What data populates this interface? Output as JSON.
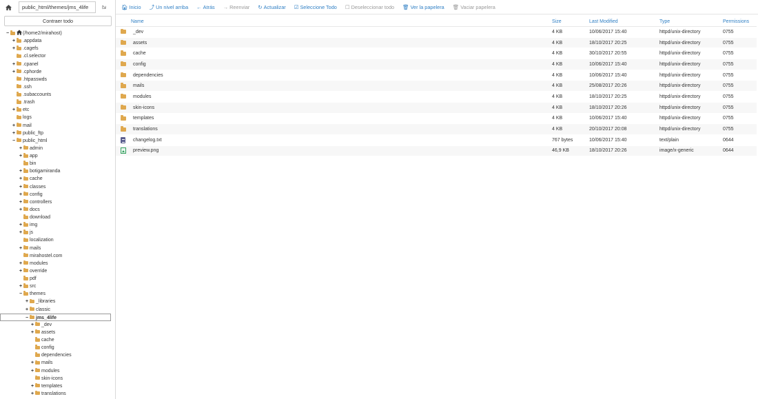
{
  "pathbar": {
    "path_value": "public_html/themes/jms_4life",
    "go_icon": "go-arrow-icon"
  },
  "sidebar": {
    "collapse_label": "Contraer todo",
    "tree": [
      {
        "label": "(/home2/mirahost)",
        "depth": 0,
        "toggle": "−",
        "icon": "home",
        "selected": false
      },
      {
        "label": ".appdata",
        "depth": 1,
        "toggle": "+",
        "icon": "folder",
        "selected": false
      },
      {
        "label": ".cagefs",
        "depth": 1,
        "toggle": "+",
        "icon": "folder",
        "selected": false
      },
      {
        "label": ".cl.selector",
        "depth": 1,
        "toggle": "",
        "icon": "folder",
        "selected": false
      },
      {
        "label": ".cpanel",
        "depth": 1,
        "toggle": "+",
        "icon": "folder",
        "selected": false
      },
      {
        "label": ".cphorde",
        "depth": 1,
        "toggle": "+",
        "icon": "folder",
        "selected": false
      },
      {
        "label": ".htpasswds",
        "depth": 1,
        "toggle": "",
        "icon": "folder",
        "selected": false
      },
      {
        "label": ".ssh",
        "depth": 1,
        "toggle": "",
        "icon": "folder",
        "selected": false
      },
      {
        "label": ".subaccounts",
        "depth": 1,
        "toggle": "",
        "icon": "folder",
        "selected": false
      },
      {
        "label": ".trash",
        "depth": 1,
        "toggle": "",
        "icon": "folder",
        "selected": false
      },
      {
        "label": "etc",
        "depth": 1,
        "toggle": "+",
        "icon": "folder",
        "selected": false
      },
      {
        "label": "logs",
        "depth": 1,
        "toggle": "",
        "icon": "folder",
        "selected": false
      },
      {
        "label": "mail",
        "depth": 1,
        "toggle": "+",
        "icon": "folder",
        "selected": false
      },
      {
        "label": "public_ftp",
        "depth": 1,
        "toggle": "+",
        "icon": "folder",
        "selected": false
      },
      {
        "label": "public_html",
        "depth": 1,
        "toggle": "−",
        "icon": "folder",
        "selected": false
      },
      {
        "label": "admin",
        "depth": 2,
        "toggle": "+",
        "icon": "folder",
        "selected": false
      },
      {
        "label": "app",
        "depth": 2,
        "toggle": "+",
        "icon": "folder",
        "selected": false
      },
      {
        "label": "bin",
        "depth": 2,
        "toggle": "",
        "icon": "folder",
        "selected": false
      },
      {
        "label": "botigamiranda",
        "depth": 2,
        "toggle": "+",
        "icon": "folder",
        "selected": false
      },
      {
        "label": "cache",
        "depth": 2,
        "toggle": "+",
        "icon": "folder",
        "selected": false
      },
      {
        "label": "classes",
        "depth": 2,
        "toggle": "+",
        "icon": "folder",
        "selected": false
      },
      {
        "label": "config",
        "depth": 2,
        "toggle": "+",
        "icon": "folder",
        "selected": false
      },
      {
        "label": "controllers",
        "depth": 2,
        "toggle": "+",
        "icon": "folder",
        "selected": false
      },
      {
        "label": "docs",
        "depth": 2,
        "toggle": "+",
        "icon": "folder",
        "selected": false
      },
      {
        "label": "download",
        "depth": 2,
        "toggle": "",
        "icon": "folder",
        "selected": false
      },
      {
        "label": "img",
        "depth": 2,
        "toggle": "+",
        "icon": "folder",
        "selected": false
      },
      {
        "label": "js",
        "depth": 2,
        "toggle": "+",
        "icon": "folder",
        "selected": false
      },
      {
        "label": "localization",
        "depth": 2,
        "toggle": "",
        "icon": "folder",
        "selected": false
      },
      {
        "label": "mails",
        "depth": 2,
        "toggle": "+",
        "icon": "folder",
        "selected": false
      },
      {
        "label": "mirahostel.com",
        "depth": 2,
        "toggle": "",
        "icon": "folder",
        "selected": false
      },
      {
        "label": "modules",
        "depth": 2,
        "toggle": "+",
        "icon": "folder",
        "selected": false
      },
      {
        "label": "override",
        "depth": 2,
        "toggle": "+",
        "icon": "folder",
        "selected": false
      },
      {
        "label": "pdf",
        "depth": 2,
        "toggle": "",
        "icon": "folder",
        "selected": false
      },
      {
        "label": "src",
        "depth": 2,
        "toggle": "+",
        "icon": "folder",
        "selected": false
      },
      {
        "label": "themes",
        "depth": 2,
        "toggle": "−",
        "icon": "folder",
        "selected": false
      },
      {
        "label": "_libraries",
        "depth": 3,
        "toggle": "+",
        "icon": "folder",
        "selected": false
      },
      {
        "label": "classic",
        "depth": 3,
        "toggle": "+",
        "icon": "folder",
        "selected": false
      },
      {
        "label": "jms_4life",
        "depth": 3,
        "toggle": "−",
        "icon": "folder",
        "selected": true
      },
      {
        "label": "_dev",
        "depth": 4,
        "toggle": "+",
        "icon": "folder",
        "selected": false
      },
      {
        "label": "assets",
        "depth": 4,
        "toggle": "+",
        "icon": "folder",
        "selected": false
      },
      {
        "label": "cache",
        "depth": 4,
        "toggle": "",
        "icon": "folder",
        "selected": false
      },
      {
        "label": "config",
        "depth": 4,
        "toggle": "",
        "icon": "folder",
        "selected": false
      },
      {
        "label": "dependencies",
        "depth": 4,
        "toggle": "",
        "icon": "folder",
        "selected": false
      },
      {
        "label": "mails",
        "depth": 4,
        "toggle": "+",
        "icon": "folder",
        "selected": false
      },
      {
        "label": "modules",
        "depth": 4,
        "toggle": "+",
        "icon": "folder",
        "selected": false
      },
      {
        "label": "skin-icons",
        "depth": 4,
        "toggle": "",
        "icon": "folder",
        "selected": false
      },
      {
        "label": "templates",
        "depth": 4,
        "toggle": "+",
        "icon": "folder",
        "selected": false
      },
      {
        "label": "translations",
        "depth": 4,
        "toggle": "+",
        "icon": "folder",
        "selected": false
      }
    ]
  },
  "toolbar": {
    "buttons": [
      {
        "name": "home",
        "icon": "home-icon",
        "glyph": "🏠︎",
        "label": "Inicio",
        "enabled": true
      },
      {
        "name": "up-one-level",
        "icon": "level-up-icon",
        "glyph": "⤴",
        "label": "Un nivel arriba",
        "enabled": true
      },
      {
        "name": "back",
        "icon": "arrow-left-icon",
        "glyph": "←",
        "label": "Atrás",
        "enabled": true
      },
      {
        "name": "forward",
        "icon": "arrow-right-icon",
        "glyph": "→",
        "label": "Reenviar",
        "enabled": false
      },
      {
        "name": "reload",
        "icon": "refresh-icon",
        "glyph": "↻",
        "label": "Actualizar",
        "enabled": true
      },
      {
        "name": "select-all",
        "icon": "checkbox-checked-icon",
        "glyph": "☑",
        "label": "Seleccione Todo",
        "enabled": true
      },
      {
        "name": "unselect-all",
        "icon": "checkbox-empty-icon",
        "glyph": "☐",
        "label": "Deseleccionar todo",
        "enabled": false
      },
      {
        "name": "view-trash",
        "icon": "trash-icon",
        "glyph": "🗑︎",
        "label": "Ver la papelera",
        "enabled": true
      },
      {
        "name": "empty-trash",
        "icon": "trash-icon",
        "glyph": "🗑︎",
        "label": "Vaciar papelera",
        "enabled": false
      }
    ]
  },
  "table": {
    "headers": {
      "name": "Name",
      "size": "Size",
      "modified": "Last Modified",
      "type": "Type",
      "perms": "Permissions"
    },
    "rows": [
      {
        "icon": "folder",
        "name": "_dev",
        "size": "4 KB",
        "modified": "10/06/2017 15:40",
        "type": "httpd/unix-directory",
        "perms": "0755"
      },
      {
        "icon": "folder",
        "name": "assets",
        "size": "4 KB",
        "modified": "18/10/2017 20:25",
        "type": "httpd/unix-directory",
        "perms": "0755"
      },
      {
        "icon": "folder",
        "name": "cache",
        "size": "4 KB",
        "modified": "30/10/2017 20:55",
        "type": "httpd/unix-directory",
        "perms": "0755"
      },
      {
        "icon": "folder",
        "name": "config",
        "size": "4 KB",
        "modified": "10/06/2017 15:40",
        "type": "httpd/unix-directory",
        "perms": "0755"
      },
      {
        "icon": "folder",
        "name": "dependencies",
        "size": "4 KB",
        "modified": "10/06/2017 15:40",
        "type": "httpd/unix-directory",
        "perms": "0755"
      },
      {
        "icon": "folder",
        "name": "mails",
        "size": "4 KB",
        "modified": "25/08/2017 20:26",
        "type": "httpd/unix-directory",
        "perms": "0755"
      },
      {
        "icon": "folder",
        "name": "modules",
        "size": "4 KB",
        "modified": "18/10/2017 20:25",
        "type": "httpd/unix-directory",
        "perms": "0755"
      },
      {
        "icon": "folder",
        "name": "skin-icons",
        "size": "4 KB",
        "modified": "18/10/2017 20:26",
        "type": "httpd/unix-directory",
        "perms": "0755"
      },
      {
        "icon": "folder",
        "name": "templates",
        "size": "4 KB",
        "modified": "10/06/2017 15:40",
        "type": "httpd/unix-directory",
        "perms": "0755"
      },
      {
        "icon": "folder",
        "name": "translations",
        "size": "4 KB",
        "modified": "20/10/2017 20:08",
        "type": "httpd/unix-directory",
        "perms": "0755"
      },
      {
        "icon": "text-file",
        "name": "changelog.txt",
        "size": "767 bytes",
        "modified": "10/06/2017 15:40",
        "type": "text/plain",
        "perms": "0644"
      },
      {
        "icon": "image-file",
        "name": "preview.png",
        "size": "46,9 KB",
        "modified": "18/10/2017 20:26",
        "type": "image/x-generic",
        "perms": "0644"
      }
    ]
  }
}
